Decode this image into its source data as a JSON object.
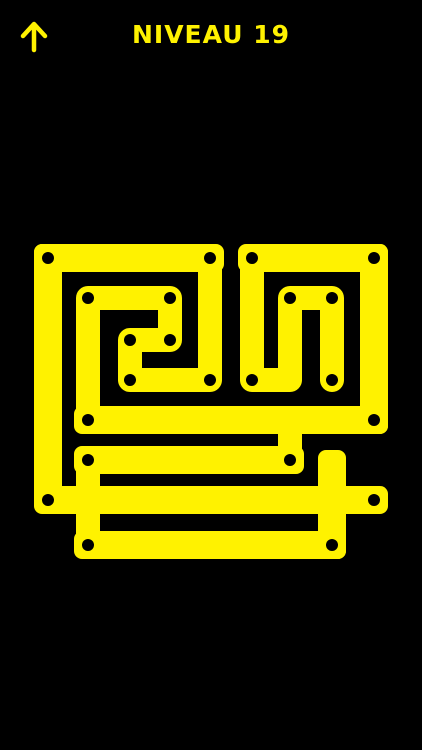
{
  "header": {
    "back_icon": "arrow-up-icon",
    "level_title": "NIVEAU 19"
  },
  "theme": {
    "background": "#000000",
    "accent": "#FFF200"
  },
  "puzzle": {
    "pieces": [
      "square-spiral-left",
      "square-spiral-right",
      "lower-bar-left",
      "lower-bar-right"
    ]
  }
}
